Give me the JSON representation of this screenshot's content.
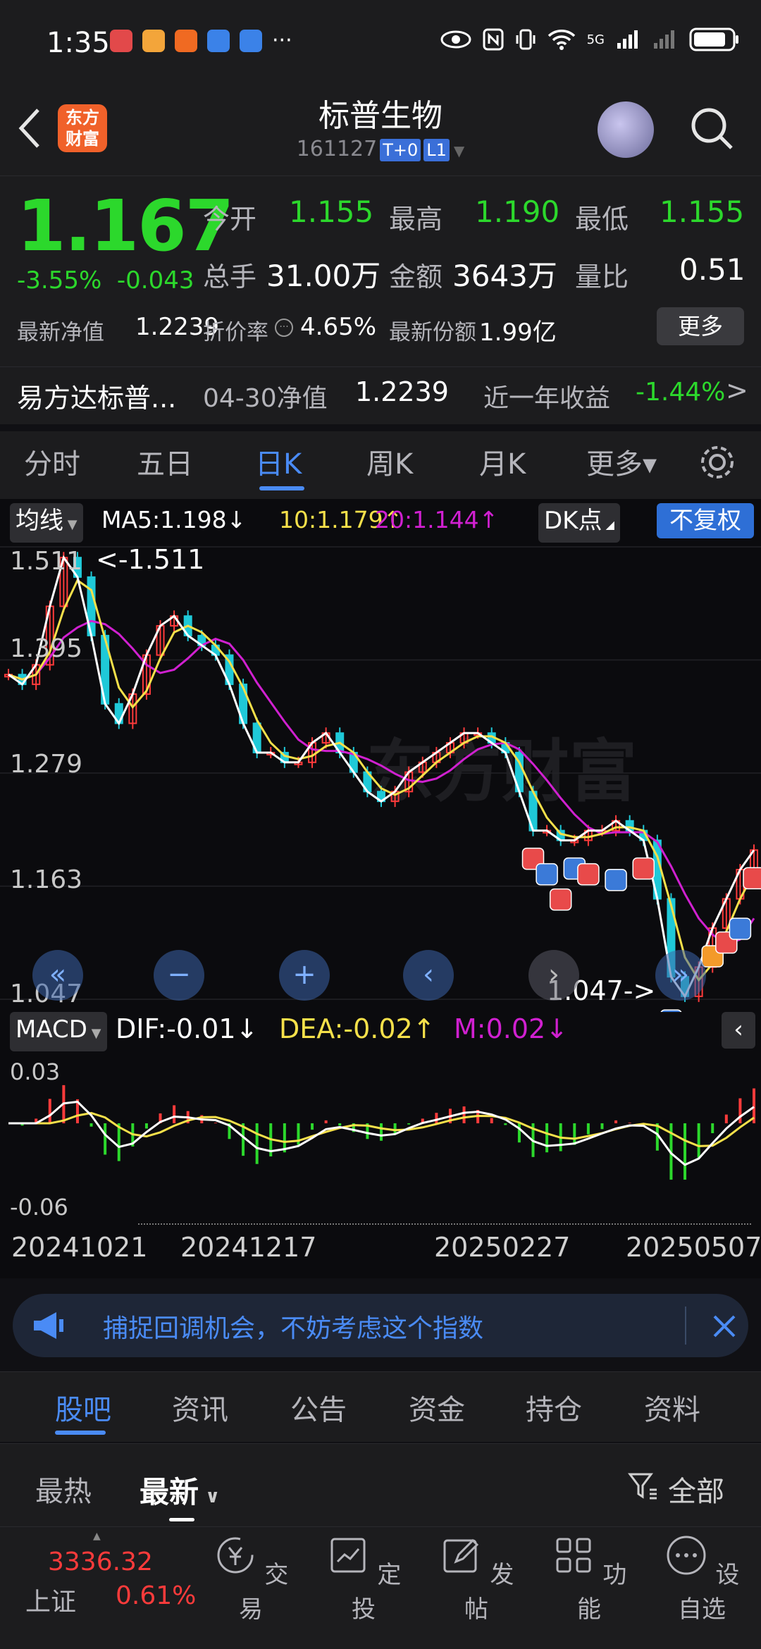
{
  "status_bar": {
    "time": "1:35",
    "more": "···",
    "network": "5G"
  },
  "header": {
    "logo_text": "东方财富",
    "title": "标普生物",
    "code": "161127",
    "tags": [
      "T+0",
      "L1"
    ]
  },
  "quote": {
    "price": "1.167",
    "change_pct": "-3.55%",
    "change": "-0.043",
    "open_label": "今开",
    "open": "1.155",
    "high_label": "最高",
    "high": "1.190",
    "low_label": "最低",
    "low": "1.155",
    "volume_label": "总手",
    "volume": "31.00万",
    "amount_label": "金额",
    "amount": "3643万",
    "ratio_label": "量比",
    "ratio": "0.51",
    "nav_label": "最新净值",
    "nav": "1.2239",
    "discount_label": "折价率",
    "discount": "4.65%",
    "shares_label": "最新份额",
    "shares": "1.99亿",
    "more_label": "更多"
  },
  "fund_row": {
    "name": "易方达标普...",
    "nav_date_label": "04-30净值",
    "nav": "1.2239",
    "yearly_label": "近一年收益",
    "yearly": "-1.44%",
    "arrow": ">"
  },
  "tabs": [
    "分时",
    "五日",
    "日K",
    "周K",
    "月K",
    "更多▾"
  ],
  "ma": {
    "selector": "均线",
    "ma5": "MA5:1.198",
    "ma5_dir": "↓",
    "ma10": "10:1.179",
    "ma10_dir": "↑",
    "ma20": "20:1.144",
    "ma20_dir": "↑",
    "dk": "DK点",
    "fq": "不复权",
    "watermark": "东方财富"
  },
  "y_labels": [
    "1.511",
    "1.395",
    "1.279",
    "1.163",
    "1.047"
  ],
  "annotations": {
    "high": "<-1.511",
    "low": "1.047->"
  },
  "macd": {
    "selector": "MACD",
    "dif": "DIF:-0.01",
    "dif_dir": "↓",
    "dea": "DEA:-0.02",
    "dea_dir": "↑",
    "m": "M:0.02",
    "m_dir": "↓",
    "y_top": "0.03",
    "y_bottom": "-0.06"
  },
  "x_labels": [
    "20241021",
    "20241217",
    "20250227",
    "20250507"
  ],
  "banner": {
    "text": "捕捉回调机会，不妨考虑这个指数"
  },
  "subtabs": [
    "股吧",
    "资讯",
    "公告",
    "资金",
    "持仓",
    "资料"
  ],
  "sort": {
    "hot": "最热",
    "latest": "最新",
    "filter": "全部"
  },
  "bottom_nav": {
    "index_value": "3336.32",
    "index_name": "上证",
    "index_change": "0.61%",
    "items": [
      "交易",
      "定投",
      "发帖",
      "功能",
      "设自选"
    ]
  },
  "colors": {
    "up": "#ff3b3b",
    "down": "#2cd82c",
    "accent": "#4a8bf5",
    "ma5": "#ffffff",
    "ma10": "#f5e04a",
    "ma20": "#d020d0"
  },
  "chart_data": {
    "type": "candlestick",
    "ma5_close_series": [
      1.38,
      1.37,
      1.39,
      1.45,
      1.5,
      1.48,
      1.42,
      1.35,
      1.33,
      1.36,
      1.4,
      1.43,
      1.44,
      1.42,
      1.41,
      1.4,
      1.37,
      1.33,
      1.3,
      1.3,
      1.29,
      1.29,
      1.31,
      1.32,
      1.3,
      1.28,
      1.26,
      1.25,
      1.26,
      1.28,
      1.29,
      1.3,
      1.31,
      1.32,
      1.32,
      1.31,
      1.3,
      1.26,
      1.22,
      1.22,
      1.21,
      1.21,
      1.22,
      1.22,
      1.23,
      1.22,
      1.21,
      1.15,
      1.07,
      1.05,
      1.08,
      1.12,
      1.15,
      1.18,
      1.2
    ],
    "ylim": [
      1.047,
      1.511
    ]
  }
}
